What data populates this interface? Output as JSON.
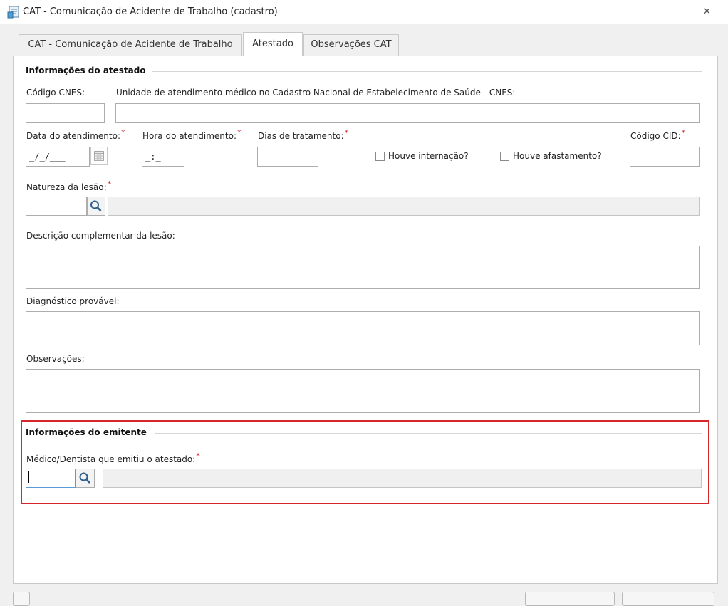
{
  "window": {
    "title": "CAT - Comunicação de Acidente de Trabalho (cadastro)",
    "close_glyph": "✕"
  },
  "tabs": [
    {
      "label": "CAT - Comunicação de Acidente de Trabalho",
      "active": false
    },
    {
      "label": "Atestado",
      "active": true
    },
    {
      "label": "Observações CAT",
      "active": false
    }
  ],
  "atestado": {
    "section_title": "Informações do atestado",
    "codigo_cnes_label": "Código CNES:",
    "codigo_cnes_value": "",
    "unidade_label": "Unidade de atendimento médico no Cadastro Nacional de Estabelecimento de Saúde - CNES:",
    "unidade_value": "",
    "data_label": "Data do atendimento:",
    "data_value": "_/_/___",
    "hora_label": "Hora do atendimento:",
    "hora_value": "_:_",
    "dias_label": "Dias de tratamento:",
    "dias_value": "",
    "internacao_label": "Houve internação?",
    "internacao_checked": false,
    "afastamento_label": "Houve afastamento?",
    "afastamento_checked": false,
    "cid_label": "Código CID:",
    "cid_value": "",
    "natureza_label": "Natureza da lesão:",
    "natureza_code": "",
    "natureza_desc": "",
    "descricao_label": "Descrição complementar da lesão:",
    "descricao_value": "",
    "diagnostico_label": "Diagnóstico provável:",
    "diagnostico_value": "",
    "observacoes_label": "Observações:",
    "observacoes_value": ""
  },
  "emitente": {
    "section_title": "Informações do emitente",
    "medico_label": "Médico/Dentista que emitiu o atestado:",
    "medico_code": "",
    "medico_name": ""
  },
  "required_mark": "*",
  "icons": {
    "app": "report-form-icon",
    "calendar": "calendar-icon",
    "search": "magnifier-icon",
    "close": "close-icon"
  },
  "colors": {
    "required": "#d8262b",
    "highlight_border": "#d6262b"
  }
}
